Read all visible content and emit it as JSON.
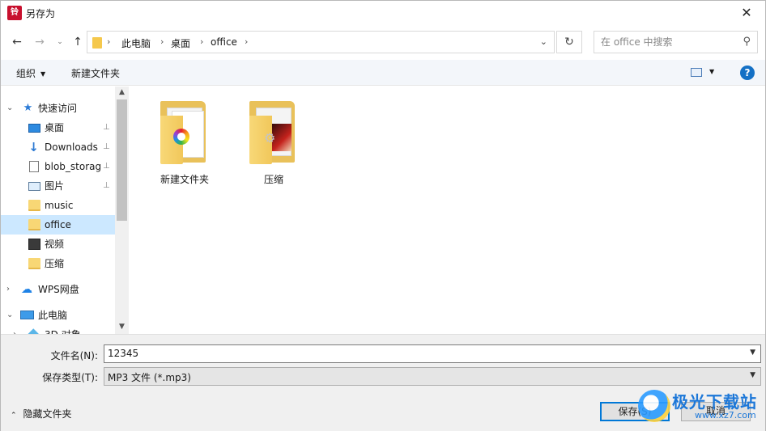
{
  "window": {
    "title": "另存为",
    "app_icon_text": "铃",
    "close_glyph": "✕"
  },
  "nav": {
    "back_glyph": "←",
    "forward_glyph": "→",
    "recent_glyph": "⌄",
    "up_glyph": "↑",
    "breadcrumb": [
      "此电脑",
      "桌面",
      "office"
    ],
    "separator": "›",
    "dropdown_glyph": "⌄",
    "refresh_glyph": "↻",
    "search_placeholder": "在 office 中搜索",
    "search_glyph": "⚲"
  },
  "toolbar": {
    "organize": "组织",
    "new_folder": "新建文件夹",
    "caret": "▼",
    "help": "?"
  },
  "sidebar": {
    "items": [
      {
        "label": "快速访问",
        "icon": "star-icon",
        "chevron": "⌄"
      },
      {
        "label": "桌面",
        "icon": "desktop-icon",
        "pinned": true
      },
      {
        "label": "Downloads",
        "icon": "download-icon",
        "pinned": true
      },
      {
        "label": "blob_storag",
        "icon": "document-icon",
        "pinned": true
      },
      {
        "label": "图片",
        "icon": "pictures-icon",
        "pinned": true
      },
      {
        "label": "music",
        "icon": "folder-icon"
      },
      {
        "label": "office",
        "icon": "folder-icon",
        "selected": true
      },
      {
        "label": "视频",
        "icon": "video-icon"
      },
      {
        "label": "压缩",
        "icon": "folder-icon"
      },
      {
        "label": "WPS网盘",
        "icon": "cloud-icon",
        "chevron": "›"
      },
      {
        "label": "此电脑",
        "icon": "computer-icon",
        "chevron": "⌄"
      },
      {
        "label": "3D 对象",
        "icon": "3d-objects-icon",
        "chevron": "›"
      }
    ],
    "pin_glyph": "📌"
  },
  "content": {
    "folders": [
      {
        "name": "新建文件夹"
      },
      {
        "name": "压缩"
      }
    ]
  },
  "form": {
    "filename_label": "文件名(N):",
    "filename_value": "12345",
    "filetype_label": "保存类型(T):",
    "filetype_value": "MP3 文件 (*.mp3)",
    "hide_folders": "隐藏文件夹",
    "hide_caret": "⌃",
    "save": "保存(S)",
    "cancel": "取消"
  },
  "watermark": {
    "title": "极光下载站",
    "url": "www.xz7.com"
  },
  "colors": {
    "selection": "#cce8ff",
    "accent": "#0078d7",
    "folder": "#f8d775"
  }
}
